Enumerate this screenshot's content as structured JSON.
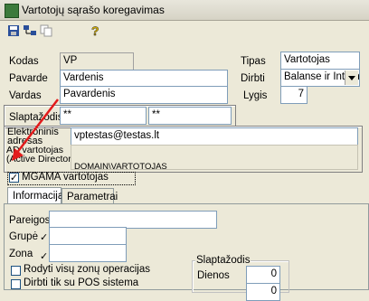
{
  "window": {
    "title": "Vartotojų sąrašo koregavimas"
  },
  "toolbar": {
    "icons": [
      "save-icon",
      "users-tree-icon",
      "copy-icon",
      "help-icon"
    ]
  },
  "form": {
    "kodas_label": "Kodas",
    "kodas_value": "VP",
    "pavarde_label": "Pavarde",
    "pavarde_value": "Vardenis",
    "vardas_label": "Vardas",
    "vardas_value": "Pavardenis",
    "tipas_label": "Tipas",
    "tipas_value": "Vartotojas",
    "dirbti_label": "Dirbti",
    "dirbti_value": "Balanse ir Intern",
    "lygis_label": "Lygis",
    "lygis_value": "7",
    "slaptazodis_label": "Slaptažodis",
    "slaptazodis_value1": "**",
    "slaptazodis_value2": "**",
    "email_label_line1": "Elektroninis",
    "email_label_line2": "adresas",
    "email_value": "vptestas@testas.lt",
    "ad_label_line1": "AD vartotojas",
    "ad_label_line2": "(Active Directory)",
    "ad_value": "DOMAIN\\VARTOTOJAS",
    "mgama_label": "MGAMA vartotojas",
    "mgama_checked": true
  },
  "tabs": [
    {
      "label": "Informacija",
      "active": true
    },
    {
      "label": "Parametrai",
      "active": false
    }
  ],
  "info": {
    "pareigos_label": "Pareigos",
    "pareigos_value": "",
    "grupe_label": "Grupė",
    "zona_label": "Zona",
    "opt1_label": "Rodyti visų zonų operacijas",
    "opt2_label": "Dirbti tik su POS sistema",
    "pw_group_label": "Slaptažodis",
    "dienos_label": "Dienos",
    "dienos_value": "0",
    "dienos_value2": "0"
  },
  "colors": {
    "annotation_arrow": "#e31b1b",
    "field_border": "#7f9db9"
  }
}
